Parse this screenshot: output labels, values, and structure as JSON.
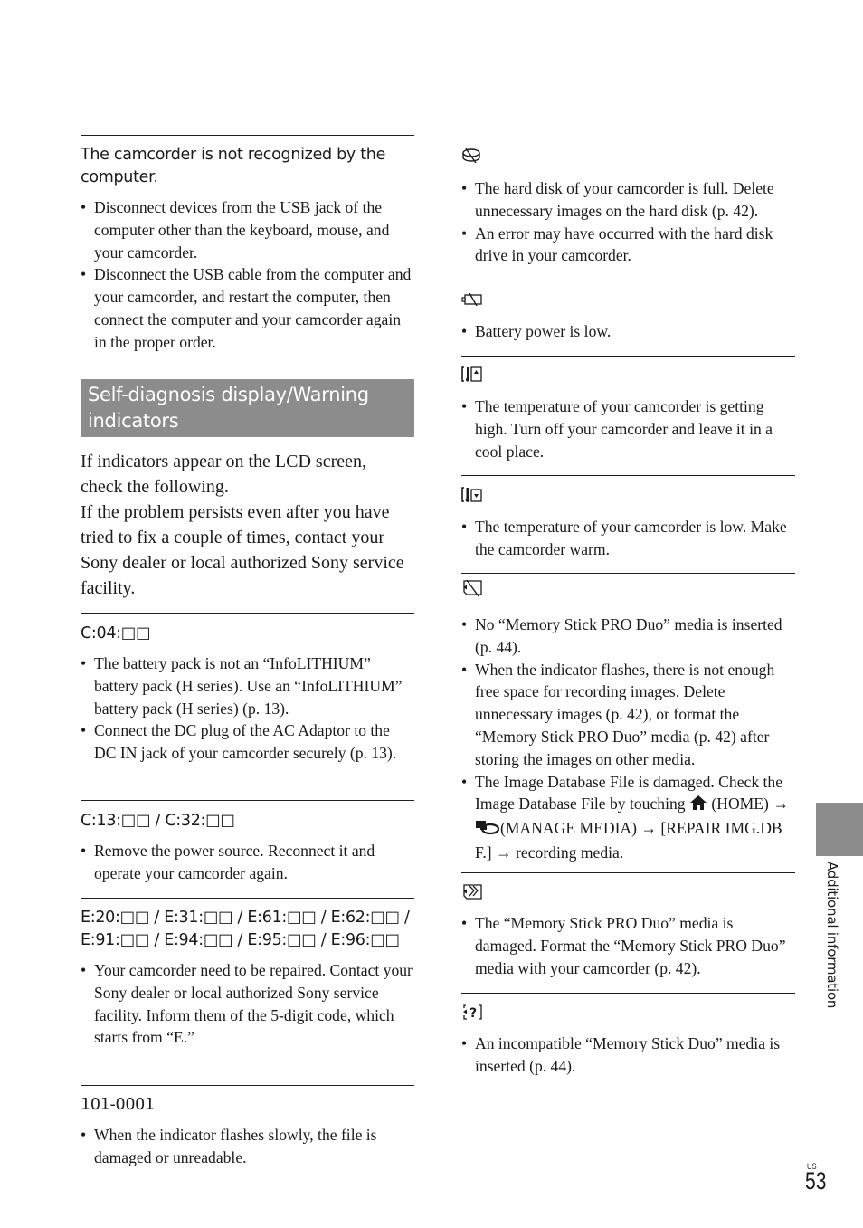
{
  "left_column": {
    "not_recognized": {
      "heading": "The camcorder is not recognized by the computer.",
      "bullets": [
        "Disconnect devices from the USB jack of the computer other than the keyboard, mouse, and your camcorder.",
        "Disconnect the USB cable from the computer and your camcorder, and restart the computer, then connect the computer and your camcorder again in the proper order."
      ]
    },
    "section_title": "Self-diagnosis display/Warning indicators",
    "intro_1": "If indicators appear on the LCD screen, check the following.",
    "intro_2": "If the problem persists even after you have tried to fix a couple of times, contact your Sony dealer or local authorized Sony service facility.",
    "c04": {
      "heading": "C:04:□□",
      "bullets": [
        "The battery pack is not an “InfoLITHIUM” battery pack (H series). Use an “InfoLITHIUM” battery pack (H series) (p. 13).",
        "Connect the DC plug of the AC Adaptor to the DC IN jack of your camcorder securely (p. 13)."
      ]
    },
    "c13": {
      "heading": "C:13:□□ / C:32:□□",
      "bullets": [
        "Remove the power source. Reconnect it and operate your camcorder again."
      ]
    },
    "e_codes": {
      "heading": "E:20:□□ / E:31:□□ / E:61:□□ / E:62:□□ / E:91:□□ / E:94:□□ / E:95:□□ / E:96:□□",
      "bullets": [
        "Your camcorder need to be repaired. Contact your Sony dealer or local authorized Sony service facility. Inform them of the 5-digit code, which starts from “E.”"
      ]
    },
    "code_101": {
      "heading": "101-0001",
      "bullets": [
        "When the indicator flashes slowly, the file is damaged or unreadable."
      ]
    }
  },
  "right_column": {
    "hdd": {
      "icon": "hard-disk-warning-icon",
      "bullets": [
        "The hard disk of your camcorder is full. Delete unnecessary images on the hard disk (p. 42).",
        "An error may have occurred with the hard disk drive in your camcorder."
      ]
    },
    "battery": {
      "icon": "battery-low-icon",
      "bullets": [
        "Battery power is low."
      ]
    },
    "temp_high": {
      "icon": "temperature-high-icon",
      "bullets": [
        "The temperature of your camcorder is getting high. Turn off your camcorder and leave it in a cool place."
      ]
    },
    "temp_low": {
      "icon": "temperature-low-icon",
      "bullets": [
        "The temperature of your camcorder is low. Make the camcorder warm."
      ]
    },
    "no_media": {
      "icon": "no-memory-stick-icon",
      "bullets": [
        "No “Memory Stick PRO Duo” media is inserted (p. 44).",
        "When the indicator flashes, there is not enough free space for recording images. Delete unnecessary images (p. 42), or format the “Memory Stick PRO Duo” media (p. 42) after storing the images on other media."
      ],
      "db_bullet": {
        "part1": "The Image Database File is damaged. Check the Image Database File by touching ",
        "home": "(HOME)",
        "arrow": "→",
        "manage": "(MANAGE MEDIA)",
        "repair": "[REPAIR IMG.DB F.]",
        "end": "recording media."
      }
    },
    "damaged_media": {
      "icon": "damaged-memory-stick-icon",
      "bullets": [
        "The “Memory Stick PRO Duo” media is damaged. Format the “Memory Stick PRO Duo” media with your camcorder (p. 42)."
      ]
    },
    "incompatible_media": {
      "icon": "incompatible-memory-stick-icon",
      "bullets": [
        "An incompatible “Memory Stick Duo” media is inserted (p. 44)."
      ]
    }
  },
  "side_tab": {
    "label": "Additional information"
  },
  "footer": {
    "region": "US",
    "page_number": "53"
  }
}
